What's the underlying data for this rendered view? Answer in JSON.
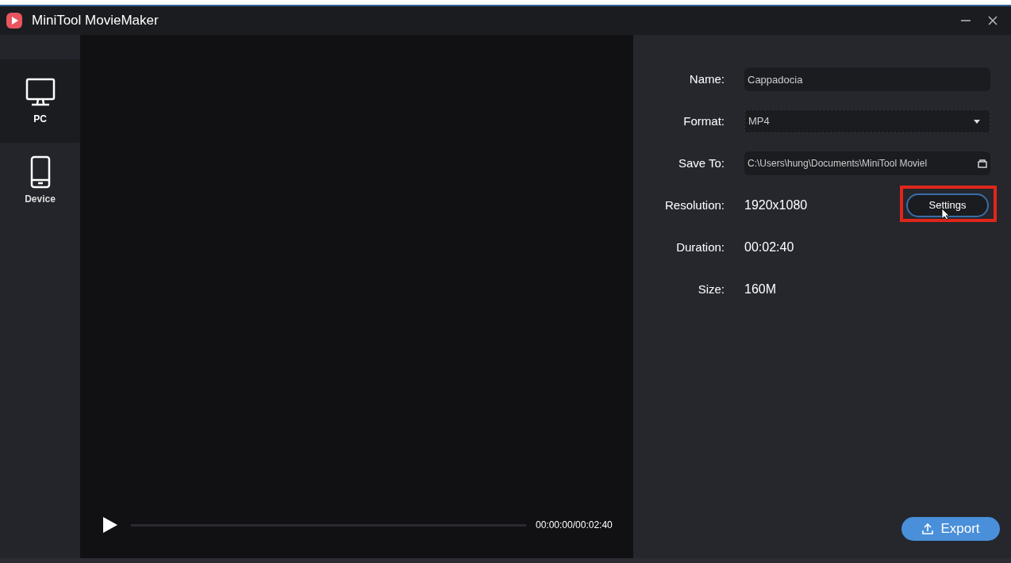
{
  "window": {
    "title": "MiniTool MovieMaker"
  },
  "sidebar": {
    "items": [
      {
        "label": "PC",
        "kind": "pc",
        "selected": true
      },
      {
        "label": "Device",
        "kind": "device",
        "selected": false
      }
    ]
  },
  "player": {
    "level": 0,
    "time": "00:00:00/00:02:40"
  },
  "fields": [
    {
      "label": "Name:",
      "kind": "text",
      "value": "Cappadocia"
    },
    {
      "label": "Format:",
      "kind": "dropdown",
      "value": "MP4"
    },
    {
      "label": "Save To:",
      "kind": "path",
      "value": "C:\\Users\\hung\\Documents\\MiniTool Moviel"
    },
    {
      "label": "Resolution:",
      "kind": "value",
      "value": "1920x1080",
      "button": {
        "label": "Settings",
        "highlighted": true
      }
    },
    {
      "label": "Duration:",
      "kind": "value",
      "value": "00:02:40"
    },
    {
      "label": "Size:",
      "kind": "value",
      "value": "160M"
    }
  ],
  "export_button": {
    "label": "Export"
  }
}
